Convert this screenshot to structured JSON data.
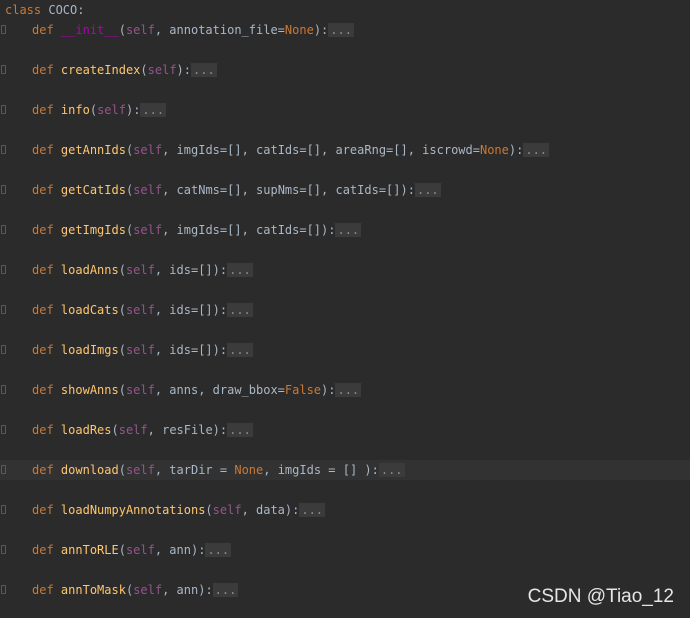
{
  "class_line": {
    "keyword": "class",
    "name": "COCO:"
  },
  "keyword_def": "def",
  "self_word": "self",
  "fold_marker": "...",
  "methods": [
    {
      "name": "__init__",
      "magic": true,
      "sig_before": ", annotation_file=",
      "none": "None",
      "sig_after": "):"
    },
    {
      "name": "createIndex",
      "sig_before": "):"
    },
    {
      "name": "info",
      "sig_before": "):"
    },
    {
      "name": "getAnnIds",
      "sig_before": ", imgIds=[], catIds=[], areaRng=[], iscrowd=",
      "none": "None",
      "sig_after": "):"
    },
    {
      "name": "getCatIds",
      "sig_before": ", catNms=[], supNms=[], catIds=[]):"
    },
    {
      "name": "getImgIds",
      "sig_before": ", imgIds=[], catIds=[]):"
    },
    {
      "name": "loadAnns",
      "sig_before": ", ids=[]):"
    },
    {
      "name": "loadCats",
      "sig_before": ", ids=[]):"
    },
    {
      "name": "loadImgs",
      "sig_before": ", ids=[]):"
    },
    {
      "name": "showAnns",
      "sig_before": ", anns, draw_bbox=",
      "none": "False",
      "sig_after": "):"
    },
    {
      "name": "loadRes",
      "sig_before": ", resFile):"
    },
    {
      "name": "download",
      "sig_before": ", tarDir = ",
      "none": "None",
      "sig_after": ", imgIds = [] ):",
      "current": true
    },
    {
      "name": "loadNumpyAnnotations",
      "sig_before": ", data):"
    },
    {
      "name": "annToRLE",
      "sig_before": ", ann):"
    },
    {
      "name": "annToMask",
      "sig_before": ", ann):"
    }
  ],
  "watermark": "CSDN @Tiao_12"
}
